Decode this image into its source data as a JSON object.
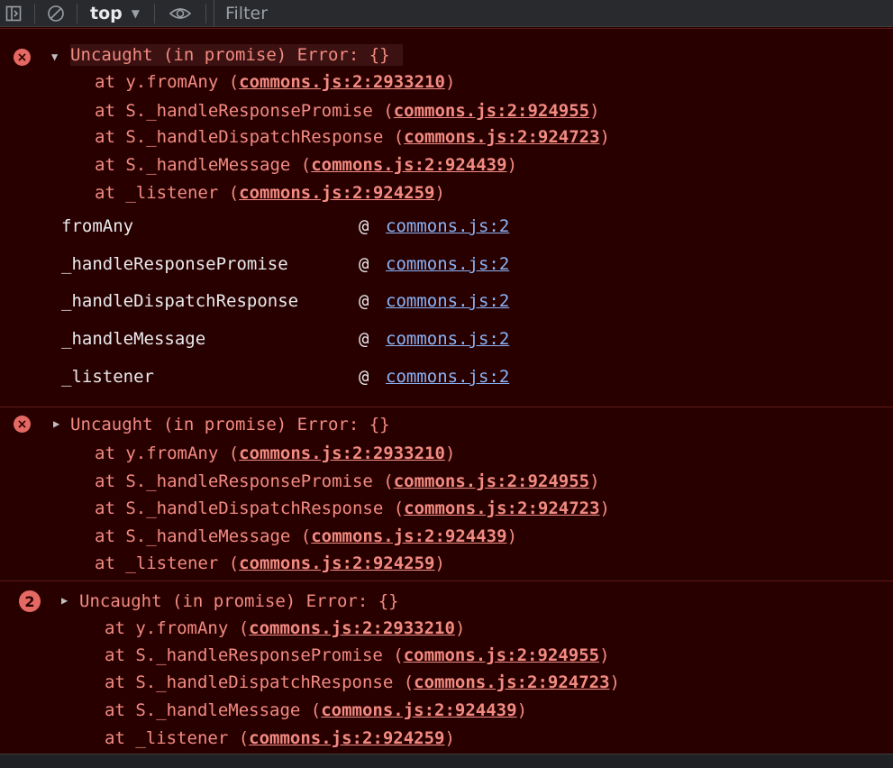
{
  "toolbar": {
    "context": "top",
    "filter_placeholder": "Filter"
  },
  "messages": [
    {
      "expanded": true,
      "header": "Uncaught (in promise) Error: {}",
      "frames": [
        {
          "prefix": "at y.fromAny (",
          "link": "commons.js:2:2933210",
          "suffix": ")"
        },
        {
          "prefix": "at S._handleResponsePromise (",
          "link": "commons.js:2:924955",
          "suffix": ")"
        },
        {
          "prefix": "at S._handleDispatchResponse (",
          "link": "commons.js:2:924723",
          "suffix": ")"
        },
        {
          "prefix": "at S._handleMessage (",
          "link": "commons.js:2:924439",
          "suffix": ")"
        },
        {
          "prefix": "at _listener (",
          "link": "commons.js:2:924259",
          "suffix": ")"
        }
      ],
      "stack_table": [
        {
          "fn": "fromAny",
          "at": "@",
          "loc": "commons.js:2"
        },
        {
          "fn": "_handleResponsePromise",
          "at": "@",
          "loc": "commons.js:2"
        },
        {
          "fn": "_handleDispatchResponse",
          "at": "@",
          "loc": "commons.js:2"
        },
        {
          "fn": "_handleMessage",
          "at": "@",
          "loc": "commons.js:2"
        },
        {
          "fn": "_listener",
          "at": "@",
          "loc": "commons.js:2"
        }
      ]
    },
    {
      "expanded": false,
      "header": "Uncaught (in promise) Error: {}",
      "frames": [
        {
          "prefix": "at y.fromAny (",
          "link": "commons.js:2:2933210",
          "suffix": ")"
        },
        {
          "prefix": "at S._handleResponsePromise (",
          "link": "commons.js:2:924955",
          "suffix": ")"
        },
        {
          "prefix": "at S._handleDispatchResponse (",
          "link": "commons.js:2:924723",
          "suffix": ")"
        },
        {
          "prefix": "at S._handleMessage (",
          "link": "commons.js:2:924439",
          "suffix": ")"
        },
        {
          "prefix": "at _listener (",
          "link": "commons.js:2:924259",
          "suffix": ")"
        }
      ]
    },
    {
      "expanded": false,
      "count": "2",
      "header": "Uncaught (in promise) Error: {}",
      "frames": [
        {
          "prefix": "at y.fromAny (",
          "link": "commons.js:2:2933210",
          "suffix": ")"
        },
        {
          "prefix": "at S._handleResponsePromise (",
          "link": "commons.js:2:924955",
          "suffix": ")"
        },
        {
          "prefix": "at S._handleDispatchResponse (",
          "link": "commons.js:2:924723",
          "suffix": ")"
        },
        {
          "prefix": "at S._handleMessage (",
          "link": "commons.js:2:924439",
          "suffix": ")"
        },
        {
          "prefix": "at _listener (",
          "link": "commons.js:2:924259",
          "suffix": ")"
        }
      ]
    }
  ],
  "colors": {
    "error_text": "#f28b82",
    "error_bg": "#290000",
    "link": "#8ab4f8",
    "badge": "#e46962"
  }
}
